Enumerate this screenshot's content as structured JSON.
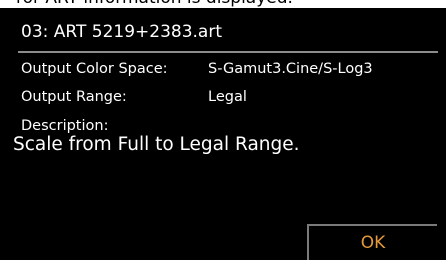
{
  "caption_fragment": "ror ART information is displayed.",
  "dialog": {
    "title": "03: ART 5219+2383.art",
    "rows": [
      {
        "label": "Output Color Space:",
        "value": "S-Gamut3.Cine/S-Log3"
      },
      {
        "label": "Output Range:",
        "value": "Legal"
      }
    ],
    "description_label": "Description:",
    "description_text": "Scale from Full to Legal Range.",
    "ok_label": "OK"
  },
  "colors": {
    "background": "#000000",
    "text": "#ffffff",
    "rule": "#8c8c8c",
    "ok_accent": "#e49a3a"
  }
}
